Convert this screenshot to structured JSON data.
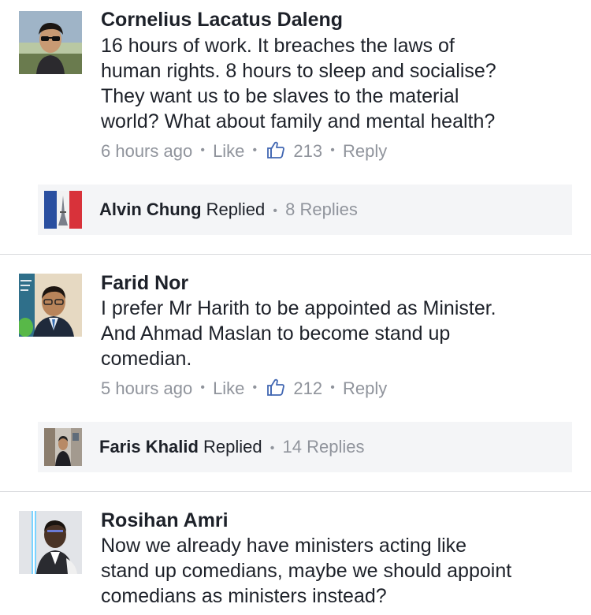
{
  "comments": [
    {
      "author": "Cornelius Lacatus Daleng",
      "avatar_icon": "person-sunglasses-avatar",
      "text_lines": [
        "16 hours of work. It breaches the laws of",
        "human rights.  8 hours to sleep and socialise?",
        "They want us to be slaves to the material",
        "world? What about family and mental health?"
      ],
      "time": "6 hours ago",
      "like_label": "Like",
      "like_count": "213",
      "reply_label": "Reply",
      "replies": {
        "name": "Alvin Chung",
        "replied_label": "Replied",
        "count_label": "8 Replies",
        "avatar_icon": "eiffel-tower-flag-avatar"
      }
    },
    {
      "author": "Farid Nor",
      "avatar_icon": "person-suit-avatar",
      "text_lines": [
        "I prefer Mr Harith to be appointed as Minister.",
        "And Ahmad Maslan to become stand up",
        "comedian."
      ],
      "time": "5 hours ago",
      "like_label": "Like",
      "like_count": "212",
      "reply_label": "Reply",
      "replies": {
        "name": "Faris Khalid",
        "replied_label": "Replied",
        "count_label": "14 Replies",
        "avatar_icon": "person-street-avatar"
      }
    },
    {
      "author": "Rosihan Amri",
      "avatar_icon": "person-lightsaber-avatar",
      "text_lines": [
        "Now we already have ministers acting like",
        "stand up comedians, maybe we should appoint",
        "comedians as ministers instead?"
      ]
    }
  ],
  "colors": {
    "text": "#1d2129",
    "meta": "#90949c",
    "reply_bg": "#f4f5f7",
    "divider": "#d8d9dc",
    "like_icon": "#4267b2"
  }
}
